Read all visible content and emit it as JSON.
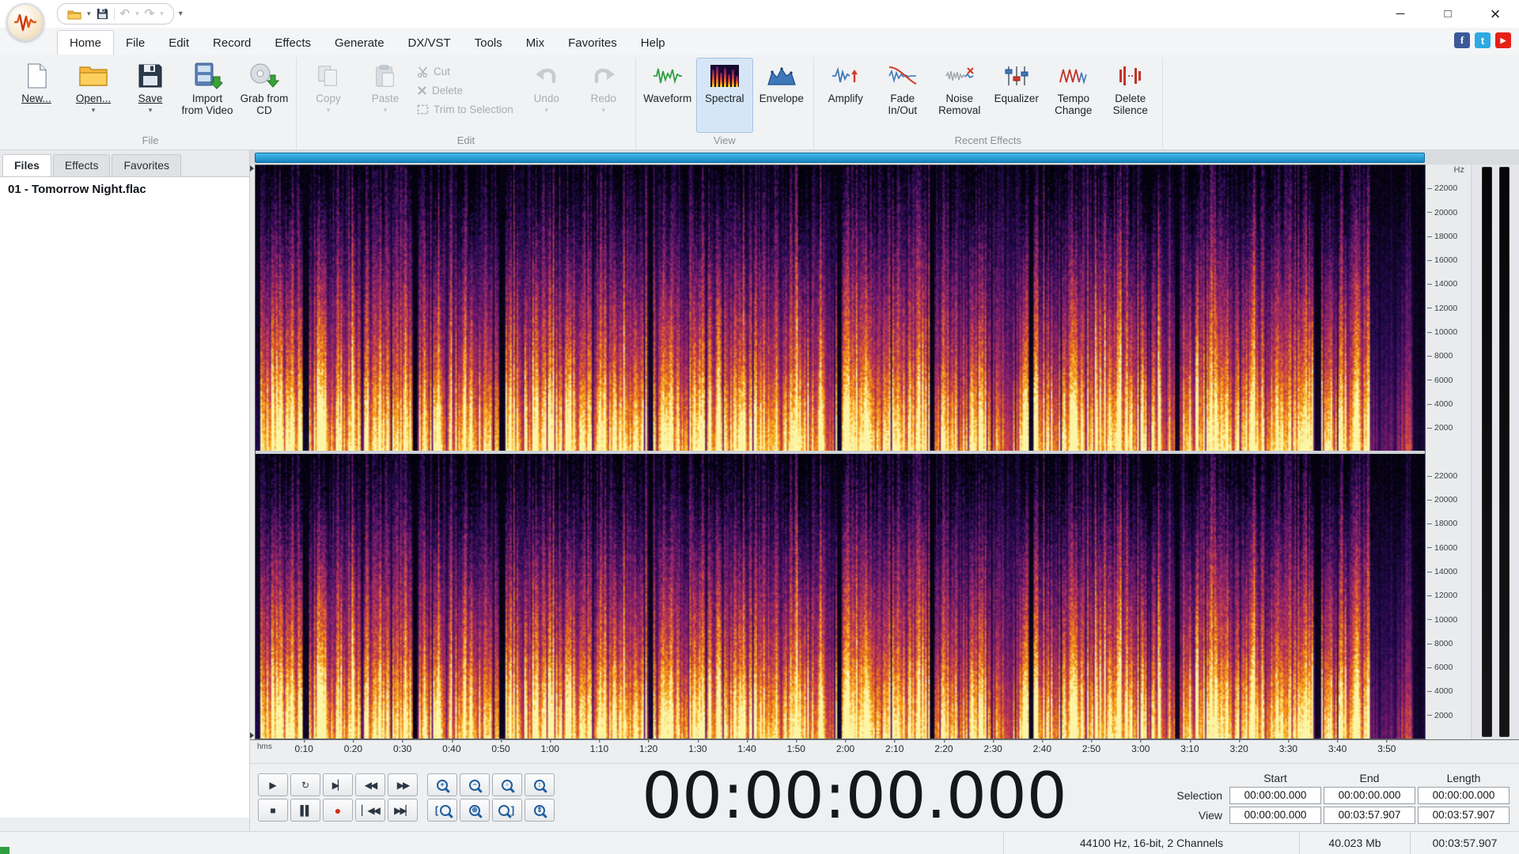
{
  "icons": {
    "dropdown": "▾",
    "undo_glyph": "↶",
    "redo_glyph": "↷",
    "minimize": "─",
    "maximize": "□",
    "close": "×",
    "facebook": "f",
    "twitter": "t",
    "youtube": "▶"
  },
  "tabs": [
    "Home",
    "File",
    "Edit",
    "Record",
    "Effects",
    "Generate",
    "DX/VST",
    "Tools",
    "Mix",
    "Favorites",
    "Help"
  ],
  "ribbon": {
    "group_labels": [
      "File",
      "Edit",
      "View",
      "Recent Effects"
    ],
    "file_buttons": [
      "New...",
      "Open...",
      "Save",
      "Import from Video",
      "Grab from CD"
    ],
    "edit_large": [
      "Copy",
      "Paste"
    ],
    "edit_small": [
      "Cut",
      "Delete",
      "Trim to Selection"
    ],
    "edit_undo": [
      "Undo",
      "Redo"
    ],
    "view_buttons": [
      "Waveform",
      "Spectral",
      "Envelope"
    ],
    "effects_buttons": [
      "Amplify",
      "Fade In/Out",
      "Noise Removal",
      "Equalizer",
      "Tempo Change",
      "Delete Silence"
    ]
  },
  "panel": {
    "tabs": [
      "Files",
      "Effects",
      "Favorites"
    ],
    "files": [
      "01 - Tomorrow Night.flac"
    ]
  },
  "freq": {
    "unit": "Hz",
    "ticks": [
      "22000",
      "20000",
      "18000",
      "16000",
      "14000",
      "12000",
      "10000",
      "8000",
      "6000",
      "4000",
      "2000"
    ]
  },
  "timeline": {
    "unit": "hms",
    "ticks": [
      "0:10",
      "0:20",
      "0:30",
      "0:40",
      "0:50",
      "1:00",
      "1:10",
      "1:20",
      "1:30",
      "1:40",
      "1:50",
      "2:00",
      "2:10",
      "2:20",
      "2:30",
      "2:40",
      "2:50",
      "3:00",
      "3:10",
      "3:20",
      "3:30",
      "3:40",
      "3:50"
    ]
  },
  "transport": {
    "play": "▶",
    "loop": "↻",
    "next": "▶▏",
    "rewind": "◀◀",
    "forward": "▶▶",
    "stop": "■",
    "pause": "▌▌",
    "record": "●",
    "to_start": "▏◀◀",
    "to_end": "▶▶▏"
  },
  "zoom": {
    "signs": [
      "+",
      "−",
      "▫",
      "↕",
      "[",
      "⊕",
      "]",
      "⇕"
    ]
  },
  "time_display": "00:00:00.000",
  "fields": {
    "headers": [
      "Start",
      "End",
      "Length"
    ],
    "rows": [
      {
        "label": "Selection",
        "start": "00:00:00.000",
        "end": "00:00:00.000",
        "length": "00:00:00.000"
      },
      {
        "label": "View",
        "start": "00:00:00.000",
        "end": "00:03:57.907",
        "length": "00:03:57.907"
      }
    ]
  },
  "status": {
    "format": "44100 Hz, 16-bit, 2 Channels",
    "size": "40.023 Mb",
    "length": "00:03:57.907"
  }
}
